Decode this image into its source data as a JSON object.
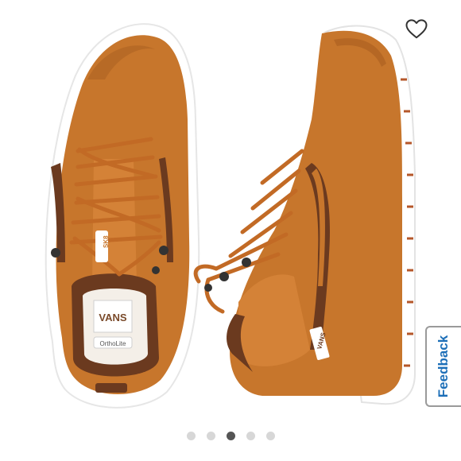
{
  "product_image": {
    "alt": "",
    "colors": {
      "suede": "#c7762c",
      "suede_dark": "#a85e20",
      "brown_trim": "#6b3a1f",
      "sole": "#ffffff",
      "background": "#ffffff"
    },
    "brand_marks": [
      "VANS",
      "OrthoLite",
      "VANS",
      "SK8"
    ]
  },
  "favorite": {
    "icon": "heart-outline-icon"
  },
  "feedback_tab": {
    "label": "Feedback",
    "color": "#1d6fb8"
  },
  "carousel": {
    "count": 5,
    "active_index": 2
  }
}
